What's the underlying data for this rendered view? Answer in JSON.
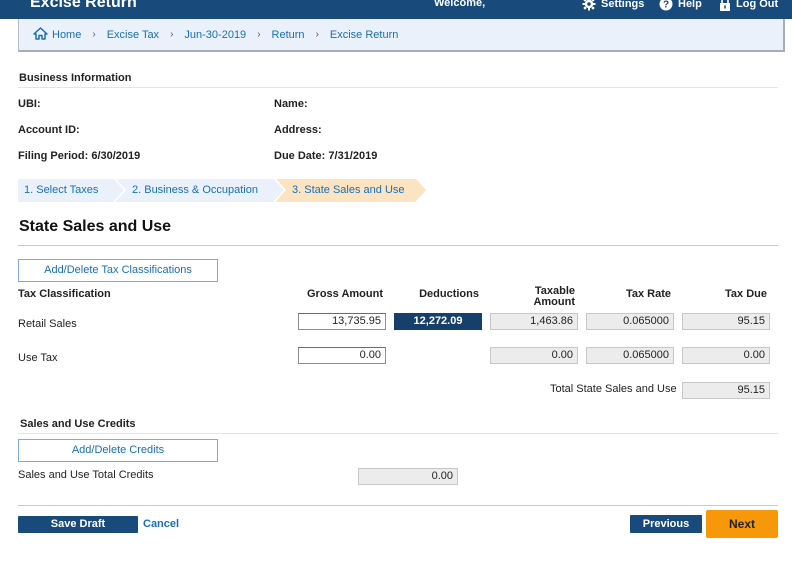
{
  "header": {
    "app_title": "Excise Return",
    "welcome": "Welcome,",
    "settings_label": "Settings",
    "help_label": "Help",
    "logout_label": "Log Out",
    "settings_icon": "gear-icon",
    "help_icon": "question-circle-icon",
    "logout_icon": "lock-icon"
  },
  "breadcrumb": {
    "home_icon": "home-icon",
    "separator": "›",
    "items": [
      "Home",
      "Excise Tax",
      "Jun-30-2019",
      "Return",
      "Excise Return"
    ]
  },
  "business_info": {
    "section_title": "Business Information",
    "ubi_label": "UBI:",
    "name_label": "Name:",
    "account_id_label": "Account ID:",
    "address_label": "Address:",
    "filing_period": "Filing Period: 6/30/2019",
    "due_date": "Due Date: 7/31/2019"
  },
  "steps": [
    {
      "label": "1. Select Taxes",
      "state": "complete"
    },
    {
      "label": "2. Business & Occupation",
      "state": "complete"
    },
    {
      "label": "3. State Sales and Use",
      "state": "current"
    }
  ],
  "main": {
    "title": "State Sales and Use",
    "add_delete_classifications": "Add/Delete Tax Classifications",
    "columns": {
      "classification": "Tax Classification",
      "gross": "Gross Amount",
      "deductions": "Deductions",
      "taxable_line1": "Taxable",
      "taxable_line2": "Amount",
      "rate": "Tax Rate",
      "due": "Tax Due"
    },
    "rows": [
      {
        "classification": "Retail Sales",
        "gross": "13,735.95",
        "deductions": "12,272.09",
        "taxable": "1,463.86",
        "rate": "0.065000",
        "due": "95.15"
      },
      {
        "classification": "Use Tax",
        "gross": "0.00",
        "deductions": "",
        "taxable": "0.00",
        "rate": "0.065000",
        "due": "0.00"
      }
    ],
    "total_label": "Total State Sales and Use",
    "total_value": "95.15"
  },
  "credits": {
    "section_title": "Sales and Use Credits",
    "add_delete_credits": "Add/Delete Credits",
    "total_label": "Sales and Use Total Credits",
    "total_value": "0.00"
  },
  "footer": {
    "save_draft": "Save Draft",
    "cancel": "Cancel",
    "previous": "Previous",
    "next": "Next"
  },
  "colors": {
    "brand_navy": "#184b7c",
    "link_blue": "#1a6fb4",
    "next_orange": "#f7970a",
    "current_step": "#fce3c2",
    "breadcrumb_bg": "#eaf1fb"
  }
}
